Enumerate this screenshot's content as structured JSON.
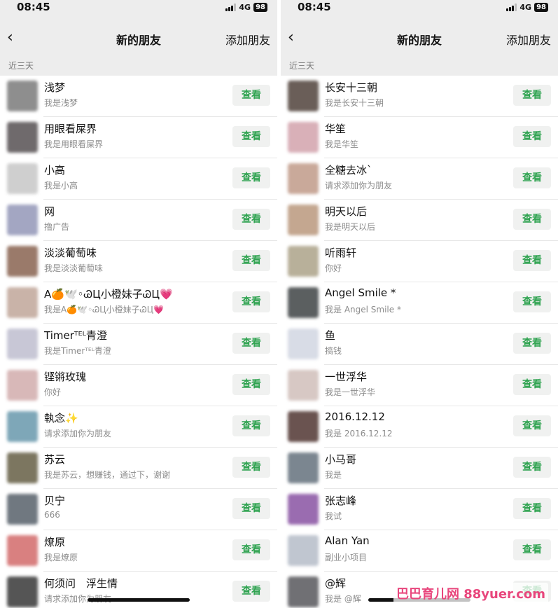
{
  "watermark": "巴巴育儿网 88yuer.com",
  "screens": [
    {
      "status": {
        "time": "08:45",
        "network": "4G",
        "battery": "98"
      },
      "nav": {
        "back": "‹",
        "title": "新的朋友",
        "add_label": "添加朋友"
      },
      "section_label": "近三天",
      "rows": [
        {
          "name": "浅梦",
          "message": "我是浅梦",
          "button": "查看",
          "avatar_color": "#8e8e8e"
        },
        {
          "name": "用眼看屎界",
          "message": "我是用眼看屎界",
          "button": "查看",
          "avatar_color": "#6f6a6c"
        },
        {
          "name": "小高",
          "message": "我是小高",
          "button": "查看",
          "avatar_color": "#cfcfcf"
        },
        {
          "name": "网",
          "message": "撸广告",
          "button": "查看",
          "avatar_color": "#a3a6c2"
        },
        {
          "name": "淡淡葡萄味",
          "message": "我是淡淡葡萄味",
          "button": "查看",
          "avatar_color": "#9a7a6a"
        },
        {
          "name": "A🍊🕊️◦ᏊЦ小橙妹子ᏊЦ💗",
          "message": "我是A🍊🕊️◦ᏊЦ小橙妹子ᏊЦ💗",
          "button": "查看",
          "avatar_color": "#c9b3a8"
        },
        {
          "name": "Timerᵀᴱᴸ青澄",
          "message": "我是Timerᵀᴱᴸ青澄",
          "button": "查看",
          "avatar_color": "#c8c7d6"
        },
        {
          "name": "铿锵玫瑰",
          "message": "你好",
          "button": "查看",
          "avatar_color": "#d8b8b8"
        },
        {
          "name": "執念✨",
          "message": "请求添加你为朋友",
          "button": "查看",
          "avatar_color": "#7ea7b8"
        },
        {
          "name": "苏云",
          "message": "我是苏云，想赚钱，通过下，谢谢",
          "button": "查看",
          "avatar_color": "#7c7660"
        },
        {
          "name": "贝宁",
          "message": "666",
          "button": "查看",
          "avatar_color": "#707880"
        },
        {
          "name": "燎原",
          "message": "我是燎原",
          "button": "查看",
          "avatar_color": "#d98080"
        },
        {
          "name": "何须问　浮生情",
          "message": "请求添加你为朋友",
          "button": "查看",
          "avatar_color": "#555555"
        }
      ]
    },
    {
      "status": {
        "time": "08:45",
        "network": "4G",
        "battery": "98"
      },
      "nav": {
        "back": "‹",
        "title": "新的朋友",
        "add_label": "添加朋友"
      },
      "section_label": "近三天",
      "rows": [
        {
          "name": "长安十三朝",
          "message": "我是长安十三朝",
          "button": "查看",
          "avatar_color": "#6a5e58"
        },
        {
          "name": "华笙",
          "message": "我是华笙",
          "button": "查看",
          "avatar_color": "#d9b0b8"
        },
        {
          "name": "全糖去冰`",
          "message": "请求添加你为朋友",
          "button": "查看",
          "avatar_color": "#c9a99a"
        },
        {
          "name": "明天以后",
          "message": "我是明天以后",
          "button": "查看",
          "avatar_color": "#c4a790"
        },
        {
          "name": "听雨轩",
          "message": "你好",
          "button": "查看",
          "avatar_color": "#b8b09a"
        },
        {
          "name": "Angel Smile *",
          "message": "我是 Angel Smile *",
          "button": "查看",
          "avatar_color": "#5b5f60"
        },
        {
          "name": "鱼",
          "message": "搞钱",
          "button": "查看",
          "avatar_color": "#d8dce6"
        },
        {
          "name": "一世浮华",
          "message": "我是一世浮华",
          "button": "查看",
          "avatar_color": "#d7c8c4"
        },
        {
          "name": "2016.12.12",
          "message": "我是 2016.12.12",
          "button": "查看",
          "avatar_color": "#6a5350"
        },
        {
          "name": "小马哥",
          "message": "我是",
          "button": "查看",
          "avatar_color": "#7b8690"
        },
        {
          "name": "张志峰",
          "message": "我试",
          "button": "查看",
          "avatar_color": "#9a6cb0"
        },
        {
          "name": "Alan Yan",
          "message": "副业小项目",
          "button": "查看",
          "avatar_color": "#c0c6d0"
        },
        {
          "name": "@辉",
          "message": "我是 @辉",
          "button": "查看",
          "avatar_color": "#707074"
        }
      ]
    }
  ]
}
